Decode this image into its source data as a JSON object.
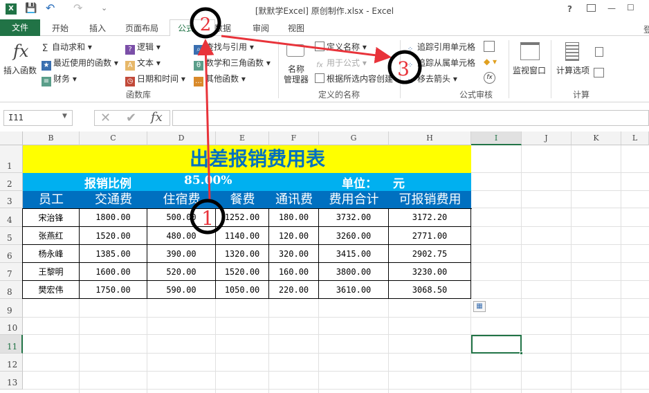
{
  "window": {
    "title": "[默默学Excel] 原创制作.xlsx - Excel",
    "help": "?",
    "minimize": "—",
    "maximize": "☐",
    "close": "✕",
    "account": "登"
  },
  "qat": {
    "excel": "X",
    "save": "💾",
    "undo": "↶",
    "redo": "↷",
    "more": "⌄"
  },
  "tabs": [
    "文件",
    "开始",
    "插入",
    "页面布局",
    "公式",
    "数据",
    "审阅",
    "视图"
  ],
  "ribbon": {
    "insert_function": "插入函数",
    "library": [
      "自动求和",
      "最近使用的函数",
      "财务",
      "逻辑",
      "文本",
      "日期和时间",
      "查找与引用",
      "数学和三角函数",
      "其他函数"
    ],
    "library_group": "函数库",
    "name_manager": "名称\n管理器",
    "names": [
      "定义名称",
      "用于公式",
      "根据所选内容创建"
    ],
    "names_group": "定义的名称",
    "audit": [
      "追踪引用单元格",
      "追踪从属单元格",
      "移去箭头"
    ],
    "audit_group": "公式审核",
    "watch": "监视窗口",
    "calc_options": "计算选项",
    "calc_group": "计算"
  },
  "formula_bar": {
    "name_box": "I11",
    "cancel": "✕",
    "enter": "✔",
    "fx": "fx",
    "value": ""
  },
  "columns": [
    "B",
    "C",
    "D",
    "E",
    "F",
    "G",
    "H",
    "I",
    "J",
    "K",
    "L"
  ],
  "rows": [
    "1",
    "2",
    "3",
    "4",
    "5",
    "6",
    "7",
    "8",
    "9",
    "10",
    "11",
    "12",
    "13"
  ],
  "sheet": {
    "title": "出差报销费用表",
    "ratio_label": "报销比例",
    "ratio_value": "85.00%",
    "unit_label": "单位：",
    "unit_value": "元",
    "headers": [
      "员工",
      "交通费",
      "住宿费",
      "餐费",
      "通讯费",
      "费用合计",
      "可报销费用"
    ],
    "data": [
      [
        "宋治锋",
        "1800.00",
        "500.00",
        "1252.00",
        "180.00",
        "3732.00",
        "3172.20"
      ],
      [
        "张燕红",
        "1520.00",
        "480.00",
        "1140.00",
        "120.00",
        "3260.00",
        "2771.00"
      ],
      [
        "杨永峰",
        "1385.00",
        "390.00",
        "1320.00",
        "320.00",
        "3415.00",
        "2902.75"
      ],
      [
        "王黎明",
        "1600.00",
        "520.00",
        "1520.00",
        "160.00",
        "3800.00",
        "3230.00"
      ],
      [
        "樊宏伟",
        "1750.00",
        "590.00",
        "1050.00",
        "220.00",
        "3610.00",
        "3068.50"
      ]
    ]
  },
  "annotations": [
    "1",
    "2",
    "3"
  ],
  "colors": {
    "title_bg": "#ffff00",
    "title_text": "#0070c0",
    "ratio_bg": "#00b0f0",
    "header_bg": "#0070c0",
    "excel_green": "#217346",
    "annotation": "#e8333a"
  }
}
